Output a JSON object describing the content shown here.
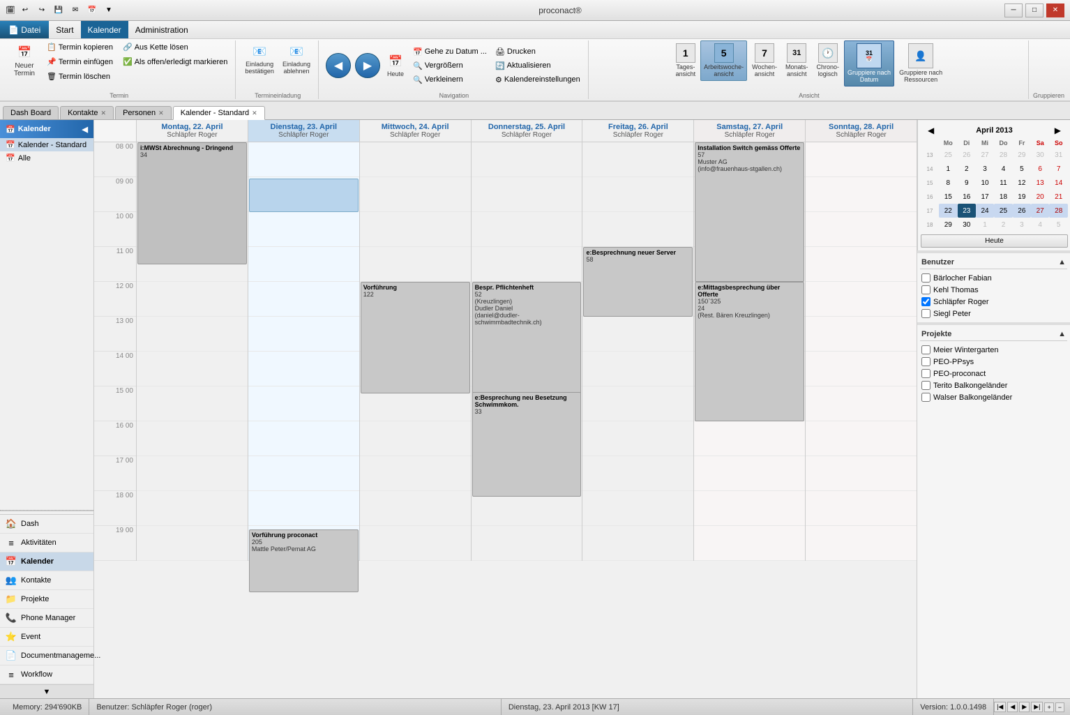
{
  "titleBar": {
    "title": "proconact®",
    "quickAccess": [
      "↩",
      "↪",
      "💾",
      "✉",
      "📅",
      "▼"
    ]
  },
  "menuBar": {
    "items": [
      {
        "label": "Datei",
        "active": true,
        "file": true
      },
      {
        "label": "Start",
        "active": false
      },
      {
        "label": "Kalender",
        "active": true,
        "underline": true
      },
      {
        "label": "Administration",
        "active": false
      }
    ]
  },
  "ribbon": {
    "groups": [
      {
        "label": "Termin",
        "buttons": [
          {
            "id": "new-termin",
            "label": "Neuer\nTermin",
            "icon": "📅",
            "large": true
          },
          {
            "id": "copy-termin",
            "label": "Termin\nkopieren",
            "icon": "📋"
          },
          {
            "id": "add-termin",
            "label": "Termin\neinfügen",
            "icon": "📌"
          },
          {
            "id": "delete-termin",
            "label": "Termin\nlöschen",
            "icon": "🗑"
          },
          {
            "id": "chain-out",
            "label": "Aus Kette\nlösen",
            "icon": "🔗"
          },
          {
            "id": "open-done",
            "label": "Als offen/erledigt\nmarkieren",
            "icon": "✅"
          }
        ]
      },
      {
        "label": "Termineinladung",
        "buttons": [
          {
            "id": "invite-confirm",
            "label": "Einladung\nbestätigen",
            "icon": "📧"
          },
          {
            "id": "invite-decline",
            "label": "Einladung\nablehnen",
            "icon": "📧"
          }
        ]
      },
      {
        "label": "Navigation",
        "buttons": [
          {
            "id": "back",
            "label": "Zurück",
            "icon": "◀"
          },
          {
            "id": "forward",
            "label": "Vorwärts",
            "icon": "▶"
          },
          {
            "id": "today",
            "label": "Heute",
            "icon": "📅"
          },
          {
            "id": "goto-date",
            "label": "Gehe zu Datum ...",
            "small": true
          },
          {
            "id": "zoom-in",
            "label": "Vergrößern",
            "small": true
          },
          {
            "id": "zoom-out",
            "label": "Verkleinern",
            "small": true
          },
          {
            "id": "print",
            "label": "Drucken",
            "small": true
          },
          {
            "id": "refresh",
            "label": "Aktualisieren",
            "small": true
          },
          {
            "id": "cal-settings",
            "label": "Kalendereinstellungen",
            "small": true
          }
        ]
      },
      {
        "label": "Ansicht",
        "buttons": [
          {
            "id": "day-view",
            "label": "Tagesansicht",
            "icon": "1"
          },
          {
            "id": "work-week-view",
            "label": "Arbeitswochenansicht",
            "icon": "5",
            "active": true
          },
          {
            "id": "week-view",
            "label": "Wochenansicht",
            "icon": "7"
          },
          {
            "id": "month-view",
            "label": "Monatsansicht",
            "icon": "31"
          },
          {
            "id": "chrono-view",
            "label": "Chronologisch",
            "icon": "🕐"
          },
          {
            "id": "group-date",
            "label": "Gruppiere nach\nDatum",
            "icon": "31",
            "active": true
          },
          {
            "id": "group-resource",
            "label": "Gruppiere nach\nRessourcen",
            "icon": "👤"
          }
        ]
      }
    ]
  },
  "tabs": [
    {
      "label": "Dash Board",
      "closable": false,
      "active": false
    },
    {
      "label": "Kontakte",
      "closable": true,
      "active": false
    },
    {
      "label": "Personen",
      "closable": true,
      "active": false
    },
    {
      "label": "Kalender - Standard",
      "closable": true,
      "active": true
    }
  ],
  "sidebar": {
    "header": "Kalender",
    "treeItems": [
      {
        "label": "Kalender - Standard",
        "icon": "📅",
        "selected": true
      },
      {
        "label": "Alle",
        "icon": "📅"
      }
    ],
    "navItems": [
      {
        "label": "Dash",
        "icon": "🏠",
        "active": false
      },
      {
        "label": "Aktivitäten",
        "icon": "≡",
        "active": false
      },
      {
        "label": "Kalender",
        "icon": "📅",
        "active": true
      },
      {
        "label": "Kontakte",
        "icon": "👥",
        "active": false
      },
      {
        "label": "Projekte",
        "icon": "📁",
        "active": false
      },
      {
        "label": "Phone Manager",
        "icon": "📞",
        "active": false
      },
      {
        "label": "Event",
        "icon": "⭐",
        "active": false
      },
      {
        "label": "Documentmanageme...",
        "icon": "📄",
        "active": false
      },
      {
        "label": "Workflow",
        "icon": "≡",
        "active": false
      }
    ]
  },
  "calendar": {
    "days": [
      {
        "label": "Montag, 22. April",
        "person": "Schläpfer Roger",
        "today": false,
        "weekend": false
      },
      {
        "label": "Dienstag, 23. April",
        "person": "Schläpfer Roger",
        "today": true,
        "weekend": false
      },
      {
        "label": "Mittwoch, 24. April",
        "person": "Schläpfer Roger",
        "today": false,
        "weekend": false
      },
      {
        "label": "Donnerstag, 25. April",
        "person": "Schläpfer Roger",
        "today": false,
        "weekend": false
      },
      {
        "label": "Freitag, 26. April",
        "person": "Schläpfer Roger",
        "today": false,
        "weekend": false
      },
      {
        "label": "Samstag, 27. April",
        "person": "Schläpfer Roger",
        "today": false,
        "weekend": true
      },
      {
        "label": "Sonntag, 28. April",
        "person": "Schläpfer Roger",
        "today": false,
        "weekend": true
      }
    ],
    "timeSlots": [
      "08 00",
      "09 00",
      "10 00",
      "11 00",
      "12 00",
      "13 00",
      "14 00",
      "15 00",
      "16 00",
      "17 00",
      "18 00",
      "19 00"
    ],
    "events": [
      {
        "id": "ev1",
        "dayIndex": 0,
        "startSlot": 0,
        "duration": 3,
        "topOffset": 0,
        "title": "i:MWSt Abrechnung - Dringend",
        "detail": "34",
        "type": "gray"
      },
      {
        "id": "ev2",
        "dayIndex": 1,
        "startSlot": 1,
        "duration": 1,
        "topOffset": 0,
        "title": "",
        "detail": "",
        "type": "blue-light"
      },
      {
        "id": "ev3",
        "dayIndex": 5,
        "startSlot": 0,
        "duration": 4,
        "topOffset": 0,
        "title": "Installation Switch gemäss Offerte",
        "detail": "57\nMuster AG\n(info@frauenhaus-stgallen.ch)",
        "type": "gray"
      },
      {
        "id": "ev4",
        "dayIndex": 2,
        "startSlot": 4,
        "duration": 3,
        "topOffset": 0,
        "title": "Vorführung",
        "detail": "122",
        "type": "gray"
      },
      {
        "id": "ev5",
        "dayIndex": 3,
        "startSlot": 4,
        "duration": 4,
        "topOffset": 0,
        "title": "Bespr. Pflichtenheft",
        "detail": "52\n(Kreuzlingen)\nDudler Daniel\n(daniel@dudler-schwimmbadtechnik.ch)",
        "type": "gray"
      },
      {
        "id": "ev6",
        "dayIndex": 4,
        "startSlot": 3,
        "duration": 2,
        "topOffset": 0,
        "title": "e:Besprechnung neuer Server",
        "detail": "58",
        "type": "gray"
      },
      {
        "id": "ev7",
        "dayIndex": 5,
        "startSlot": 4,
        "duration": 4,
        "topOffset": 0,
        "title": "e:Mittagsbesprechung über Offerte",
        "detail": "150`325\n24\n(Rest. Bären Kreuzlingen)",
        "type": "gray"
      },
      {
        "id": "ev8",
        "dayIndex": 3,
        "startSlot": 7,
        "duration": 3,
        "topOffset": 0,
        "title": "e:Besprechung neu Besetzung Schwimmkom.",
        "detail": "33",
        "type": "gray"
      },
      {
        "id": "ev9",
        "dayIndex": 1,
        "startSlot": 11,
        "duration": 2,
        "topOffset": 0,
        "title": "Vorführung proconact",
        "detail": "205\nMattle Peter/Pemat AG",
        "type": "gray"
      }
    ]
  },
  "miniCalendar": {
    "month": "April 2013",
    "headers": [
      "Mo",
      "Di",
      "Mi",
      "Do",
      "Fr",
      "Sa",
      "So"
    ],
    "weeks": [
      [
        {
          "num": 13,
          "label": "25",
          "otherMonth": true
        },
        {
          "num": "",
          "label": "26",
          "otherMonth": true
        },
        {
          "num": "",
          "label": "27",
          "otherMonth": true
        },
        {
          "num": "",
          "label": "28",
          "otherMonth": true
        },
        {
          "num": "",
          "label": "29",
          "otherMonth": true
        },
        {
          "num": "",
          "label": "30",
          "otherMonth": true
        },
        {
          "num": "",
          "label": "31",
          "otherMonth": true
        }
      ],
      [
        {
          "num": 14,
          "label": "1"
        },
        {
          "num": "",
          "label": "2"
        },
        {
          "num": "",
          "label": "3"
        },
        {
          "num": "",
          "label": "4"
        },
        {
          "num": "",
          "label": "5"
        },
        {
          "num": "",
          "label": "6",
          "weekend": true
        },
        {
          "num": "",
          "label": "7",
          "weekend": true
        }
      ],
      [
        {
          "num": 15,
          "label": "8"
        },
        {
          "num": "",
          "label": "9"
        },
        {
          "num": "",
          "label": "10"
        },
        {
          "num": "",
          "label": "11"
        },
        {
          "num": "",
          "label": "12"
        },
        {
          "num": "",
          "label": "13",
          "weekend": true
        },
        {
          "num": "",
          "label": "14",
          "weekend": true
        }
      ],
      [
        {
          "num": 16,
          "label": "15"
        },
        {
          "num": "",
          "label": "16"
        },
        {
          "num": "",
          "label": "17"
        },
        {
          "num": "",
          "label": "18"
        },
        {
          "num": "",
          "label": "19"
        },
        {
          "num": "",
          "label": "20",
          "weekend": true
        },
        {
          "num": "",
          "label": "21",
          "weekend": true
        }
      ],
      [
        {
          "num": 17,
          "label": "22",
          "selectedWeek": true
        },
        {
          "num": "",
          "label": "23",
          "today": true
        },
        {
          "num": "",
          "label": "24",
          "selectedWeek": true
        },
        {
          "num": "",
          "label": "25",
          "selectedWeek": true
        },
        {
          "num": "",
          "label": "26",
          "selectedWeek": true
        },
        {
          "num": "",
          "label": "27",
          "weekend": true,
          "selectedWeek": true
        },
        {
          "num": "",
          "label": "28",
          "weekend": true,
          "selectedWeek": true
        }
      ],
      [
        {
          "num": 18,
          "label": "29"
        },
        {
          "num": "",
          "label": "30"
        },
        {
          "num": "",
          "label": "1",
          "otherMonth": true
        },
        {
          "num": "",
          "label": "2",
          "otherMonth": true
        },
        {
          "num": "",
          "label": "3",
          "otherMonth": true
        },
        {
          "num": "",
          "label": "4",
          "otherMonth": true
        },
        {
          "num": "",
          "label": "5",
          "otherMonth": true
        }
      ]
    ],
    "todayLabel": "Heute"
  },
  "usersPanel": {
    "title": "Benutzer",
    "users": [
      {
        "name": "Bärlocher Fabian",
        "checked": false
      },
      {
        "name": "Kehl Thomas",
        "checked": false
      },
      {
        "name": "Schläpfer Roger",
        "checked": true
      },
      {
        "name": "Siegl Peter",
        "checked": false
      }
    ]
  },
  "projectsPanel": {
    "title": "Projekte",
    "items": [
      {
        "name": "Meier Wintergarten",
        "checked": false
      },
      {
        "name": "PEO-PPsys",
        "checked": false
      },
      {
        "name": "PEO-proconact",
        "checked": false
      },
      {
        "name": "Terito Balkongeländer",
        "checked": false
      },
      {
        "name": "Walser Balkongeländer",
        "checked": false
      }
    ]
  },
  "statusBar": {
    "memory": "Memory: 294'690KB",
    "user": "Benutzer: Schläpfer Roger (roger)",
    "date": "Dienstag, 23. April 2013 [KW 17]",
    "version": "Version: 1.0.0.1498"
  }
}
